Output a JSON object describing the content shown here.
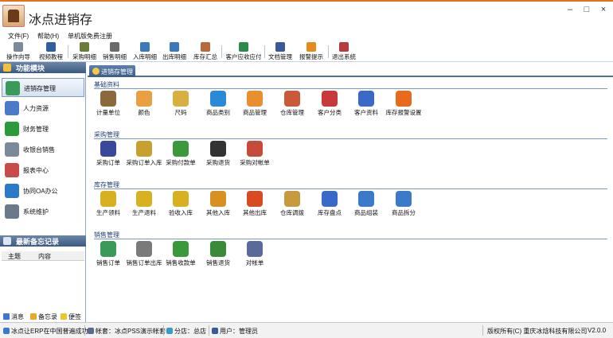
{
  "window": {
    "title": "冰点进销存",
    "controls": {
      "minimize": "–",
      "maximize": "□",
      "close": "×"
    },
    "logo_icon": "app-logo-icon"
  },
  "menu": [
    "文件(F)",
    "帮助(H)",
    "单机版免费注册"
  ],
  "toolbar": [
    {
      "label": "操作向导",
      "icon": "wizard-icon",
      "color": "#7a8a9a"
    },
    {
      "label": "视频教程",
      "icon": "video-icon",
      "color": "#2f5f9e"
    },
    {
      "label": "采购明细",
      "icon": "purchase-detail-icon",
      "color": "#6b7c3a"
    },
    {
      "label": "销售明细",
      "icon": "sales-detail-icon",
      "color": "#6a6a6a"
    },
    {
      "label": "入库明细",
      "icon": "stock-in-icon",
      "color": "#3a7ab8"
    },
    {
      "label": "出库明细",
      "icon": "stock-out-icon",
      "color": "#3a7ab8"
    },
    {
      "label": "库存汇总",
      "icon": "inventory-icon",
      "color": "#b86a3a"
    },
    {
      "label": "客户应收应付",
      "icon": "receivable-icon",
      "color": "#2a8a4a"
    },
    {
      "label": "文档管理",
      "icon": "document-icon",
      "color": "#3a5a9a"
    },
    {
      "label": "报警提示",
      "icon": "alarm-icon",
      "color": "#e88a1a"
    },
    {
      "label": "退出系统",
      "icon": "exit-icon",
      "color": "#b83a3a"
    }
  ],
  "left_panel": {
    "header": "功能模块",
    "modules": [
      {
        "label": "进销存管理",
        "icon": "inventory-mgmt-icon",
        "color": "#3a9a5a",
        "active": true
      },
      {
        "label": "人力资源",
        "icon": "hr-icon",
        "color": "#4a7ac8",
        "active": false
      },
      {
        "label": "财务管理",
        "icon": "finance-icon",
        "color": "#2a9a3a",
        "active": false
      },
      {
        "label": "收银台销售",
        "icon": "cashier-icon",
        "color": "#7a8a9a",
        "active": false
      },
      {
        "label": "报表中心",
        "icon": "report-icon",
        "color": "#c84a4a",
        "active": false
      },
      {
        "label": "协同OA办公",
        "icon": "oa-icon",
        "color": "#2a7ac8",
        "active": false
      },
      {
        "label": "系统维护",
        "icon": "maintenance-icon",
        "color": "#6a7a8a",
        "active": false
      }
    ],
    "memo_header": "最新备忘记录",
    "memo_columns": [
      "主题",
      "内容"
    ],
    "footer": [
      {
        "label": "消息",
        "icon": "message-icon",
        "color": "#3a7ac8"
      },
      {
        "label": "备忘录",
        "icon": "memo-icon",
        "color": "#e8a830"
      },
      {
        "label": "便签",
        "icon": "note-icon",
        "color": "#e8c830"
      }
    ]
  },
  "tab": {
    "label": "进销存管理",
    "icon": "inventory-tab-icon"
  },
  "sections": [
    {
      "title": "基础资料",
      "items": [
        {
          "label": "计量单位",
          "icon": "scale-icon",
          "color": "#8a6a3a"
        },
        {
          "label": "颜色",
          "icon": "palette-icon",
          "color": "#e8a040"
        },
        {
          "label": "尺码",
          "icon": "ruler-icon",
          "color": "#d8b040"
        },
        {
          "label": "商品类别",
          "icon": "category-icon",
          "color": "#2a8ad8"
        },
        {
          "label": "商品管理",
          "icon": "goods-icon",
          "color": "#e89030"
        },
        {
          "label": "仓库管理",
          "icon": "warehouse-icon",
          "color": "#c85a3a"
        },
        {
          "label": "客户分类",
          "icon": "customer-type-icon",
          "color": "#c83a3a"
        },
        {
          "label": "客户资料",
          "icon": "customer-info-icon",
          "color": "#3a6ac8"
        },
        {
          "label": "库存报警设置",
          "icon": "stock-alarm-icon",
          "color": "#e86a1a"
        }
      ]
    },
    {
      "title": "采购管理",
      "items": [
        {
          "label": "采购订单",
          "icon": "purchase-order-icon",
          "color": "#3a4a9a"
        },
        {
          "label": "采购订单入库",
          "icon": "purchase-stockin-icon",
          "color": "#c8a030"
        },
        {
          "label": "采购付款单",
          "icon": "purchase-payment-icon",
          "color": "#3a9a3a"
        },
        {
          "label": "采购退货",
          "icon": "purchase-return-icon",
          "color": "#333333"
        },
        {
          "label": "采购对帐单",
          "icon": "purchase-statement-icon",
          "color": "#c84a3a"
        }
      ]
    },
    {
      "title": "库存管理",
      "items": [
        {
          "label": "生产领料",
          "icon": "production-pick-icon",
          "color": "#d8b020"
        },
        {
          "label": "生产退料",
          "icon": "production-return-icon",
          "color": "#d8b020"
        },
        {
          "label": "验收入库",
          "icon": "accept-stockin-icon",
          "color": "#d8b020"
        },
        {
          "label": "其他入库",
          "icon": "other-stockin-icon",
          "color": "#d89020"
        },
        {
          "label": "其他出库",
          "icon": "other-stockout-icon",
          "color": "#d84a20"
        },
        {
          "label": "仓库调拨",
          "icon": "transfer-icon",
          "color": "#c89a40"
        },
        {
          "label": "库存盘点",
          "icon": "stocktake-icon",
          "color": "#3a6ac8"
        },
        {
          "label": "商品组装",
          "icon": "assemble-icon",
          "color": "#3a7ac8"
        },
        {
          "label": "商品拆分",
          "icon": "split-icon",
          "color": "#3a7ac8"
        }
      ]
    },
    {
      "title": "销售管理",
      "items": [
        {
          "label": "销售订单",
          "icon": "sales-order-icon",
          "color": "#3a9a5a"
        },
        {
          "label": "销售订单出库",
          "icon": "sales-stockout-icon",
          "color": "#7a7a7a"
        },
        {
          "label": "销售收款单",
          "icon": "sales-receipt-icon",
          "color": "#3a9a3a"
        },
        {
          "label": "销售退货",
          "icon": "sales-return-icon",
          "color": "#3a8a3a"
        },
        {
          "label": "对帐单",
          "icon": "statement-icon",
          "color": "#5a6a9a"
        }
      ]
    }
  ],
  "statusbar": {
    "items": [
      {
        "text": "冰点让ERP在中国普遍成功",
        "icon": "info-icon",
        "color": "#3a7ac8"
      },
      {
        "text": "帐套：冰点PSS演示帐套",
        "icon": "account-icon",
        "color": "#5a6a8a"
      },
      {
        "text": "分店：总店",
        "icon": "branch-icon",
        "color": "#3a9ac8"
      },
      {
        "text": "用户：管理员",
        "icon": "user-icon",
        "color": "#3a5a9a"
      }
    ],
    "copyright": "版权所有(C) 重庆冰焓科技有限公司",
    "version": "V2.0.0"
  },
  "colors": {
    "accent": "#4d6f9c",
    "titlebar_border": "#e8701a",
    "section_title": "#1f3e7a"
  }
}
